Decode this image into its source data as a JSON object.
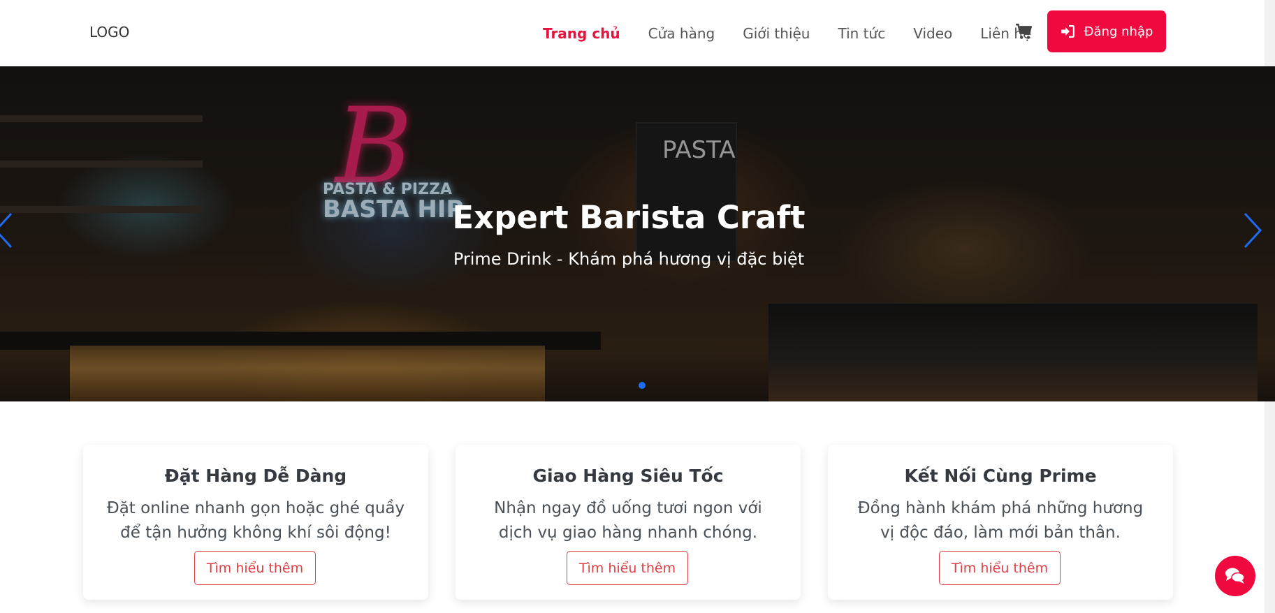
{
  "header": {
    "logo": "LOGO",
    "nav": [
      {
        "label": "Trang chủ",
        "active": true
      },
      {
        "label": "Cửa hàng"
      },
      {
        "label": "Giới thiệu"
      },
      {
        "label": "Tin tức"
      },
      {
        "label": "Video"
      },
      {
        "label": "Liên hệ"
      }
    ],
    "cart_icon": "cart-icon",
    "login_label": "Đăng nhập",
    "login_icon": "sign-in-icon"
  },
  "hero": {
    "title": "Expert Barista Craft",
    "subtitle": "Prime Drink - Khám phá hương vị đặc biệt",
    "neon_letter": "B",
    "neon_text_line1": "PASTA & PIZZA",
    "neon_text_line2": "BASTA HIP",
    "poster_text": "PASTA"
  },
  "features": [
    {
      "title": "Đặt Hàng Dễ Dàng",
      "text": "Đặt online nhanh gọn hoặc ghé quầy để tận hưởng không khí sôi động!",
      "button": "Tìm hiểu thêm"
    },
    {
      "title": "Giao Hàng Siêu Tốc",
      "text": "Nhận ngay đồ uống tươi ngon với dịch vụ giao hàng nhanh chóng.",
      "button": "Tìm hiểu thêm"
    },
    {
      "title": "Kết Nối Cùng Prime",
      "text": "Đồng hành khám phá những hương vị độc đáo, làm mới bản thân.",
      "button": "Tìm hiểu thêm"
    }
  ],
  "colors": {
    "accent": "#f0093f",
    "active_nav": "#e8123e",
    "card_button": "#e03d45",
    "carousel_dot": "#1d6cf2"
  },
  "chat_icon": "chat-icon"
}
